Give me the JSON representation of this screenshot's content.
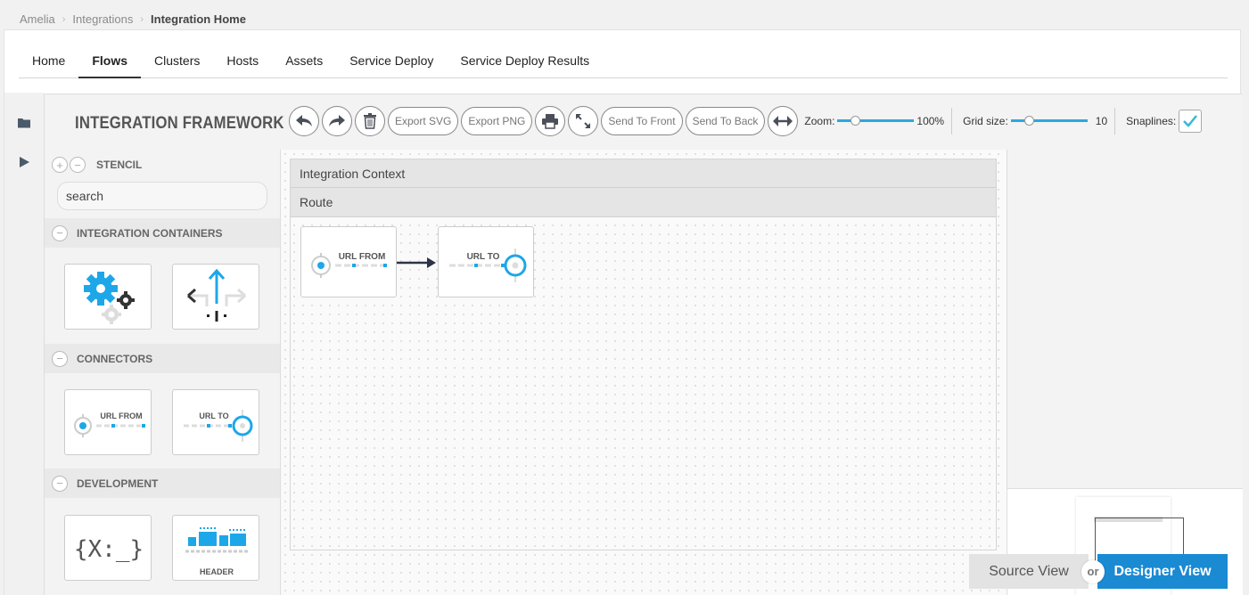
{
  "breadcrumb": {
    "items": [
      "Amelia",
      "Integrations"
    ],
    "current": "Integration Home",
    "separator": "›"
  },
  "tabs": [
    {
      "label": "Home"
    },
    {
      "label": "Flows"
    },
    {
      "label": "Clusters"
    },
    {
      "label": "Hosts"
    },
    {
      "label": "Assets"
    },
    {
      "label": "Service Deploy"
    },
    {
      "label": "Service Deploy Results"
    }
  ],
  "active_tab": "Flows",
  "app_title": "INTEGRATION FRAMEWORK",
  "toolbar": {
    "export_svg": "Export SVG",
    "export_png": "Export PNG",
    "send_to_front": "Send To Front",
    "send_to_back": "Send To Back",
    "zoom_label": "Zoom:",
    "zoom_value": "100%",
    "zoom_level": 0.2,
    "grid_label": "Grid size:",
    "grid_value": "10",
    "grid_level": 0.2,
    "snaplines_label": "Snaplines:",
    "snaplines_checked": true,
    "icons": [
      "undo-icon",
      "redo-icon",
      "trash-icon",
      "printer-icon",
      "fit-to-window-icon",
      "fit-width-icon"
    ]
  },
  "stencil": {
    "title": "STENCIL",
    "search_value": "search",
    "groups": [
      {
        "title": "INTEGRATION CONTAINERS"
      },
      {
        "title": "CONNECTORS",
        "items": [
          "URL FROM",
          "URL TO"
        ]
      },
      {
        "title": "DEVELOPMENT",
        "items": [
          "{X:_}",
          "HEADER"
        ]
      }
    ]
  },
  "canvas": {
    "context_label": "Integration Context",
    "route_label": "Route",
    "nodes": [
      "URL FROM",
      "URL TO"
    ]
  },
  "view_toggle": {
    "source": "Source View",
    "or": "or",
    "designer": "Designer View"
  },
  "colors": {
    "accent": "#29a8e0",
    "designer_btn": "#1a8ad3",
    "gear_blue": "#1ea7e8"
  }
}
